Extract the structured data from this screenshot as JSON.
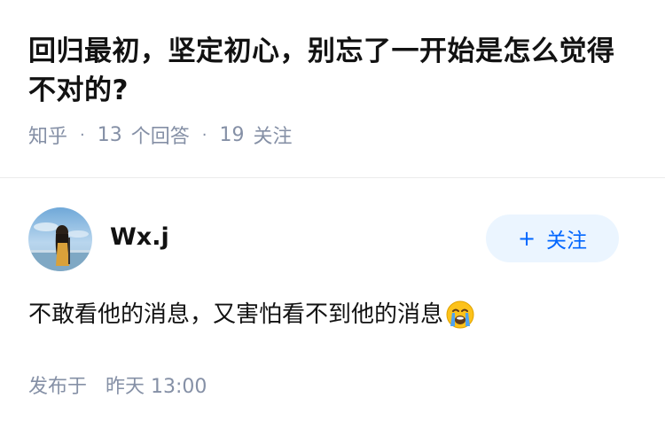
{
  "question": {
    "title": "回归最初，坚定初心，别忘了一开始是怎么觉得不对的?",
    "source": "知乎",
    "answer_count": "13",
    "answer_label": "个回答",
    "follow_count": "19",
    "follow_label": "关注"
  },
  "answer": {
    "author_name": "Wx.j",
    "follow_button_label": "关注",
    "follow_button_icon": "plus-icon",
    "content": "不敢看他的消息，又害怕看不到他的消息",
    "content_emoji": "loudly-crying-face-emoji",
    "posted_label": "发布于",
    "posted_time": "昨天 13:00"
  },
  "colors": {
    "accent": "#0066ff",
    "accent_bg": "#ebf5ff",
    "meta_text": "#8590a6",
    "title_text": "#121212",
    "divider": "#ebebeb"
  }
}
